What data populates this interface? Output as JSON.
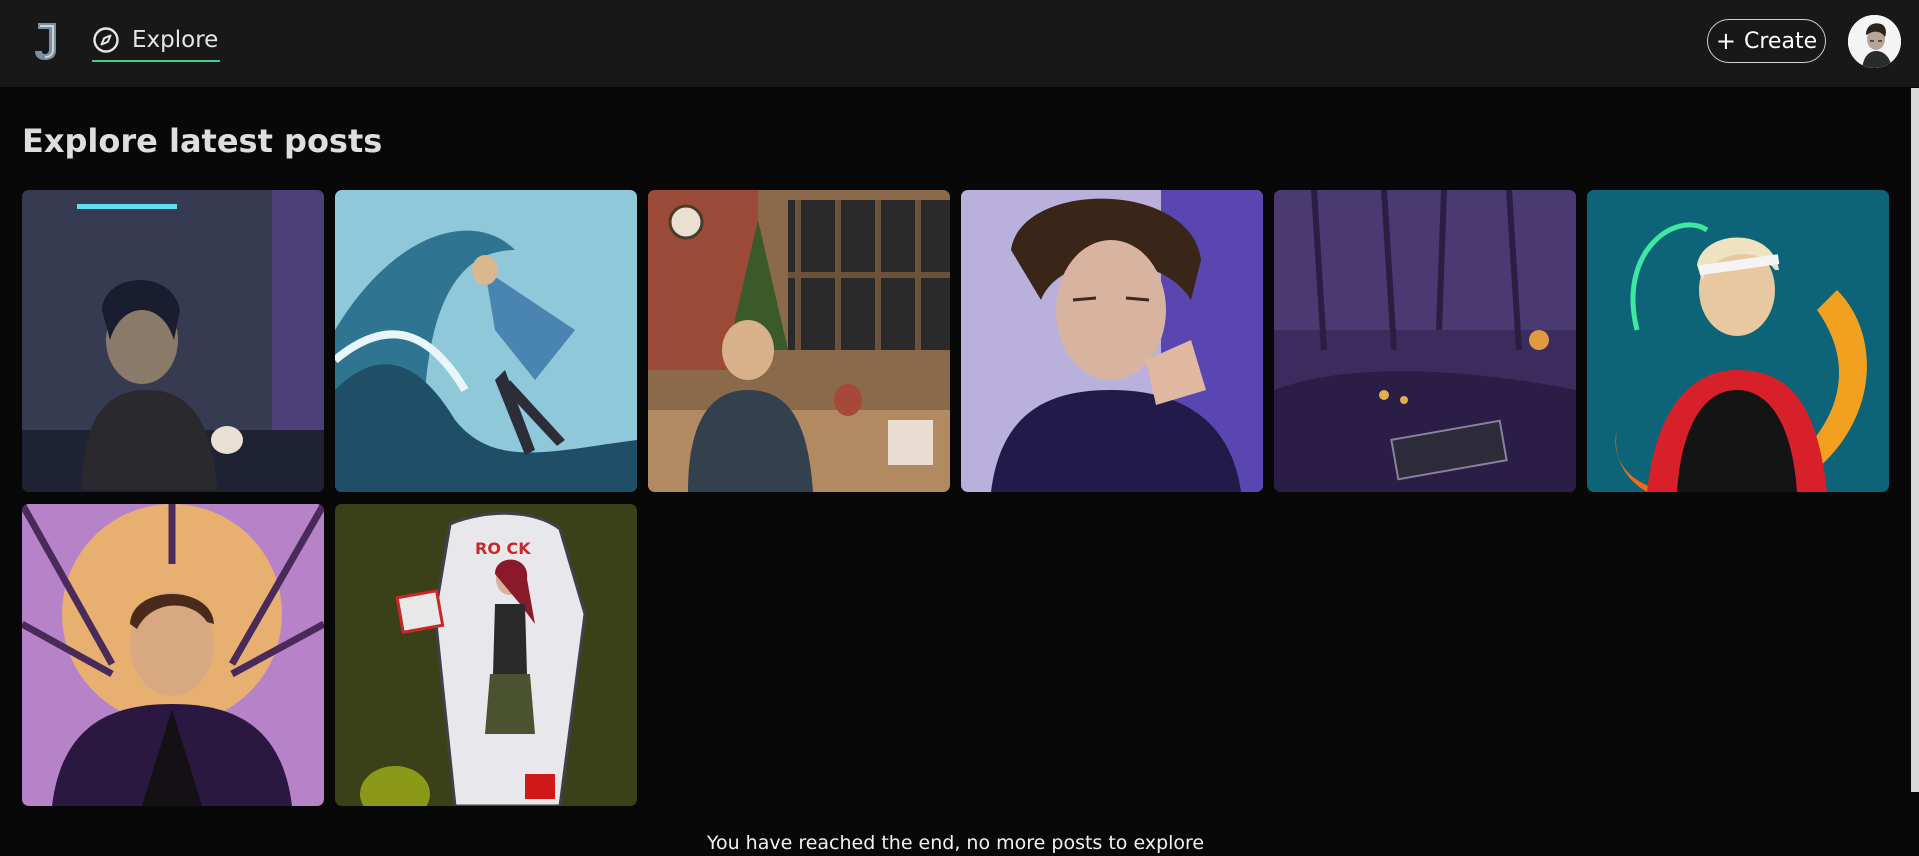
{
  "header": {
    "logo": "J",
    "nav": {
      "explore_label": "Explore",
      "icon": "compass-icon"
    },
    "create_label": "Create",
    "create_icon": "plus-icon",
    "accent": "#3fcf8e"
  },
  "main": {
    "title": "Explore latest posts",
    "posts": [
      {
        "name": "post-1",
        "colors": [
          "#3a3f57",
          "#1a1e2e"
        ]
      },
      {
        "name": "post-2",
        "colors": [
          "#6fb4cc",
          "#1d3f55"
        ]
      },
      {
        "name": "post-3",
        "colors": [
          "#a47a52",
          "#3a2a1c"
        ]
      },
      {
        "name": "post-4",
        "colors": [
          "#a99cd8",
          "#2e2258"
        ]
      },
      {
        "name": "post-5",
        "colors": [
          "#4a3a70",
          "#221838"
        ]
      },
      {
        "name": "post-6",
        "colors": [
          "#0f6e82",
          "#0b4e60"
        ]
      },
      {
        "name": "post-7",
        "colors": [
          "#c694d8",
          "#3b2150"
        ]
      },
      {
        "name": "post-8",
        "colors": [
          "#3c4218",
          "#2a2f10"
        ]
      }
    ],
    "end_message": "You have reached the end, no more posts to explore"
  }
}
